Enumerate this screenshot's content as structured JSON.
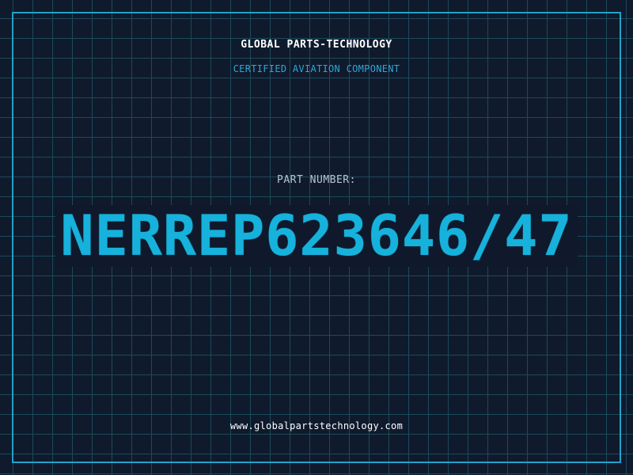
{
  "header": {
    "company_name": "GLOBAL PARTS-TECHNOLOGY",
    "tagline": "CERTIFIED AVIATION COMPONENT"
  },
  "part": {
    "label": "PART NUMBER:",
    "number": "NERREP623646/47"
  },
  "footer": {
    "website": "www.globalpartstechnology.com"
  },
  "colors": {
    "background": "#101a2d",
    "grid": "#1b4a5a",
    "frame": "#1fa3c9",
    "accent": "#16b2dc",
    "tagline": "#2aa9d6",
    "label": "#b9c4cf",
    "text": "#ffffff"
  }
}
